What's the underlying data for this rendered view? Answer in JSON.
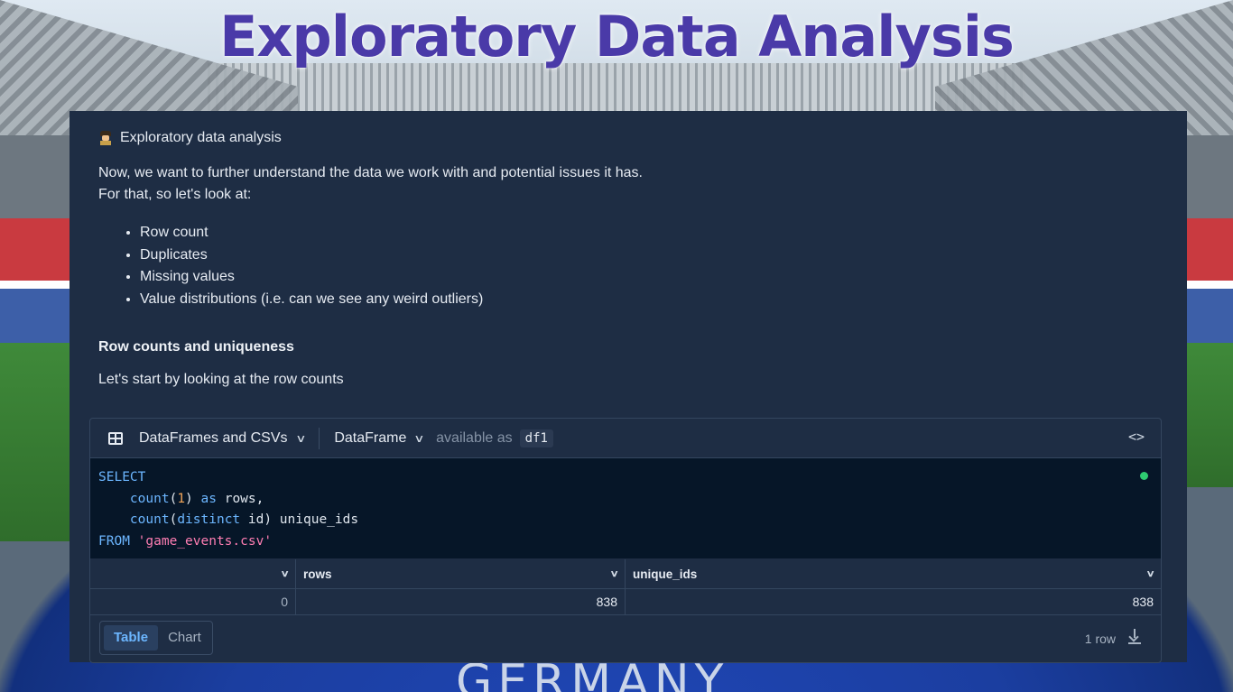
{
  "title": "Exploratory Data Analysis",
  "background_text": "GERMANY",
  "notebook": {
    "heading": "Exploratory data analysis",
    "heading_icon": "detective-icon",
    "intro_line1": "Now, we want to further understand the data we work with and potential issues it has.",
    "intro_line2": "For that, so let's look at:",
    "bullets": [
      "Row count",
      "Duplicates",
      "Missing values",
      "Value distributions (i.e. can we see any weird outliers)"
    ],
    "subheading": "Row counts and uniqueness",
    "subtext": "Let's start by looking at the row counts"
  },
  "sql_cell": {
    "source_label": "DataFrames and CSVs",
    "output_type": "DataFrame",
    "available_as": "available as",
    "variable": "df1",
    "code_toggle": "<>",
    "code": {
      "select": "SELECT",
      "count": "count",
      "one": "1",
      "as": "as",
      "rows_alias": " rows,",
      "distinct": "distinct",
      "unique_expr": " id) unique_ids",
      "from": "FROM",
      "table": "'game_events.csv'"
    },
    "status_color": "#2ecc71"
  },
  "result": {
    "columns": [
      "",
      "rows",
      "unique_ids"
    ],
    "rows": [
      [
        "0",
        "838",
        "838"
      ]
    ],
    "view_table": "Table",
    "view_chart": "Chart",
    "row_count": "1 row"
  },
  "colors": {
    "panel_bg": "#1e2d44",
    "editor_bg": "#061628",
    "title": "#4a3aa8",
    "accent": "#6cb6ff"
  }
}
